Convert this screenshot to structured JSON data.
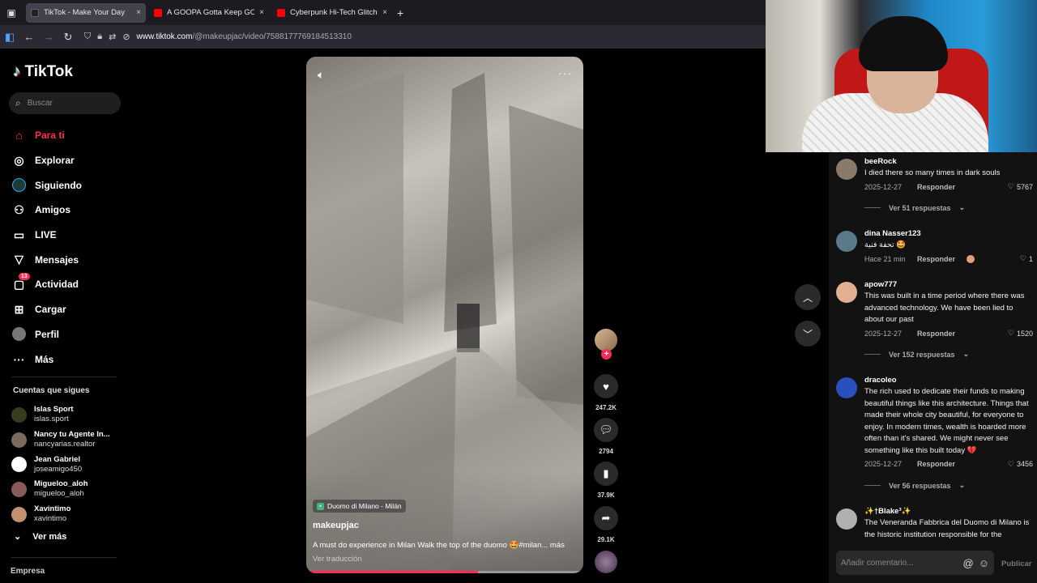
{
  "browser": {
    "tabs": [
      {
        "title": "TikTok - Make Your Day",
        "favicon_color": "#222222",
        "active": true
      },
      {
        "title": "A GOOPA Gotta Keep GOOPIN",
        "favicon_color": "#ff0000",
        "active": false
      },
      {
        "title": "Cyberpunk Hi-Tech Glitch Neon",
        "favicon_color": "#ff0000",
        "active": false
      }
    ],
    "tab_close": "×",
    "new_tab": "+",
    "url_host": "www.tiktok.com",
    "url_path": "/@makeupjac/video/7588177769184513310"
  },
  "sidebar": {
    "logo": "TikTok",
    "search_placeholder": "Buscar",
    "menu": [
      {
        "label": "Para ti",
        "icon": "home-icon",
        "active": true
      },
      {
        "label": "Explorar",
        "icon": "compass-icon"
      },
      {
        "label": "Siguiendo",
        "icon": "following-avatar-icon"
      },
      {
        "label": "Amigos",
        "icon": "friends-icon"
      },
      {
        "label": "LIVE",
        "icon": "live-icon"
      },
      {
        "label": "Mensajes",
        "icon": "messages-icon"
      },
      {
        "label": "Actividad",
        "icon": "activity-icon",
        "badge": "13"
      },
      {
        "label": "Cargar",
        "icon": "upload-icon"
      },
      {
        "label": "Perfil",
        "icon": "profile-avatar-icon"
      },
      {
        "label": "Más",
        "icon": "more-icon"
      }
    ],
    "following_title": "Cuentas que sigues",
    "following": [
      {
        "name": "Islas Sport",
        "handle": "islas.sport",
        "color": "#3a3a20"
      },
      {
        "name": "Nancy tu Agente In...",
        "handle": "nancyarias.realtor",
        "color": "#7a6a60"
      },
      {
        "name": "Jean Gabriel",
        "handle": "joseamigo450",
        "color": "#ffffff"
      },
      {
        "name": "Migueloo_aloh",
        "handle": "migueloo_aloh",
        "color": "#8a5a5a"
      },
      {
        "name": "Xavintimo",
        "handle": "xavintimo",
        "color": "#c09070"
      }
    ],
    "see_more": "Ver más",
    "company": "Empresa"
  },
  "video": {
    "location": "Duomo di Milano - Milán",
    "author": "makeupjac",
    "description": "A must do experience in Milan Walk the top of the duomo 🤩#milan... más",
    "translate": "Ver traducción",
    "progress": 0.62
  },
  "actions": {
    "likes": "247.2K",
    "comments": "2794",
    "saves": "37.9K",
    "shares": "29.1K"
  },
  "comments": [
    {
      "user": "beeRock",
      "text": "I died there so many times in dark souls",
      "date": "2025-12-27",
      "reply": "Responder",
      "likes": "5767",
      "replies": "Ver 51 respuestas",
      "avatar_color": "#8a7a6a"
    },
    {
      "user": "dina Nasser123",
      "text": "تحفة فنية 🤩",
      "date": "Hace 21 min",
      "reply": "Responder",
      "likes": "1",
      "replies": "",
      "avatar_color": "#5a7a8a"
    },
    {
      "user": "apow777",
      "text": "This was built in a time period where there was advanced technology. We have been lied to about our past",
      "date": "2025-12-27",
      "reply": "Responder",
      "likes": "1520",
      "replies": "Ver 152 respuestas",
      "avatar_color": "#e0b090"
    },
    {
      "user": "dracoleo",
      "text": "The rich used to dedicate their funds to making beautiful things like this architecture. Things that made their whole city beautiful, for everyone to enjoy. In modern times, wealth is hoarded more often than it's shared. We might never see something like this built today 💔",
      "date": "2025-12-27",
      "reply": "Responder",
      "likes": "3456",
      "replies": "Ver 56 respuestas",
      "avatar_color": "#2a50c0"
    },
    {
      "user": "✨†Blake³✨",
      "text": "The Veneranda Fabbrica del Duomo di Milano is the historic institution responsible for the",
      "date": "",
      "reply": "",
      "likes": "",
      "replies": "",
      "avatar_color": "#b0b0b0"
    }
  ],
  "comment_input": {
    "placeholder": "Añadir comentario...",
    "publish": "Publicar"
  },
  "colors": {
    "accent": "#fe2c55",
    "background": "#000000",
    "comments_bg": "#121212"
  }
}
